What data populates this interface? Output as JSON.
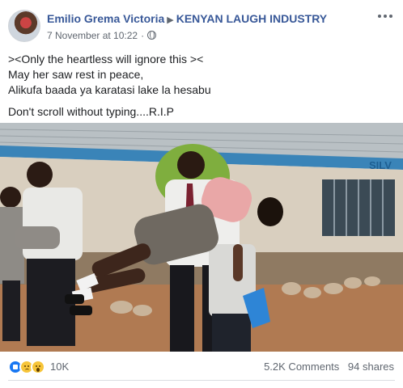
{
  "header": {
    "author": "Emilio Grema Victoria",
    "group": "KENYAN LAUGH INDUSTRY",
    "timestamp": "7 November at 10:22",
    "separator": "·"
  },
  "post": {
    "lines": [
      "><Only the heartless will ignore this ><",
      "May her saw rest in peace,",
      "Alikufa baada ya karatasi lake la hesabu"
    ],
    "footer_line": "Don't scroll without typing....R.I.P"
  },
  "photo": {
    "wall_sign": "SILV"
  },
  "reactions": {
    "icons": [
      "like-icon",
      "sad-icon",
      "wow-icon"
    ],
    "count": "10K"
  },
  "stats": {
    "comments": "5.2K Comments",
    "shares": "94 shares"
  },
  "colors": {
    "link_blue": "#385898",
    "meta_gray": "#606770",
    "like_blue": "#1877f2",
    "emoji_yellow": "#f7c53a"
  }
}
